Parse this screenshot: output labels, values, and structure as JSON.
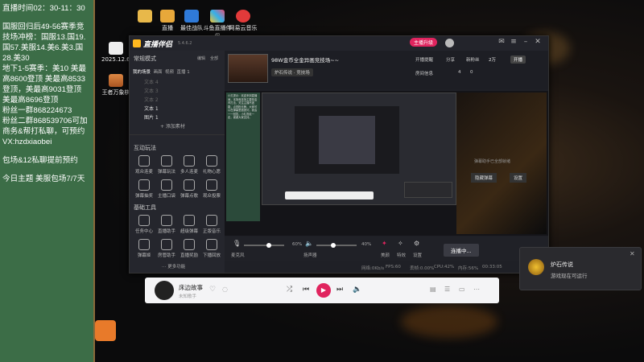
{
  "board": {
    "lines": [
      "直播时间02：30-11：30",
      "",
      "国服回归后49-56赛季竞技场冲榜：国服13.国19.国57.美服14.美6.美3.国28.美30",
      "地下1-5赛季：美10 美最高8600登顶 美最高8533登顶，美最高9031登顶 美最高8696登顶",
      "粉丝一群868224673",
      "粉丝二群868539706可加商务&帮打私聊，可预约",
      "VX:hzdxiaobei",
      "",
      "包场&12私聊提前预约",
      "",
      "今日主题  美服包场7/7天"
    ]
  },
  "desktop": {
    "icons": [
      "",
      "直播",
      "最佳战队",
      "斗鱼直播伴侣",
      "网易云音乐"
    ],
    "left_icons": [
      "2025.12.6...",
      "王者万象棋"
    ]
  },
  "app": {
    "name": "直播伴侣",
    "version": "5.4.6.2",
    "live_stream_btn": "主播升级",
    "share_label": "分享",
    "live_remind": "开播提醒",
    "upgrade": "升级",
    "new_fans": "新粉丝",
    "fans_count": "2万",
    "watch_label": "开播",
    "stream_title": "98W金币全金异画竞技场~~",
    "category": "炉石传说 · 竞技场",
    "room_info_label": "房间信息",
    "room_stat1": "4",
    "room_stat2": "0",
    "mode_label": "常规模式",
    "mode_edit": "编辑",
    "mode_more": "全部",
    "scene_tabs": [
      "我的场景",
      "画面",
      "视频",
      "直播 1"
    ],
    "scenes": [
      "文本 4",
      "文本 3",
      "文本 2",
      "文本 1",
      "图片 1"
    ],
    "add_material": "+ 添加素材",
    "tools_title": "互动玩法",
    "tools": [
      "观众连麦",
      "弹幕玩法",
      "多人连麦",
      "礼物心愿",
      "弹幕抽奖",
      "主播口袋",
      "弹幕点歌",
      "观众投票"
    ],
    "basic_title": "基础工具",
    "basic_tools": [
      "任务中心",
      "直播助手",
      "超级弹幕",
      "正版音乐",
      "弹幕姬",
      "房管助手",
      "直播奖励",
      "下播回放"
    ],
    "more_functions": "更多功能",
    "mic_label": "麦克风",
    "mic_pct": "60%",
    "spk_label": "扬声器",
    "spk_pct": "40%",
    "beauty_label": "美颜",
    "effects_label": "特效",
    "settings_label": "设置",
    "connect_btn": "连播中...",
    "status_items": [
      "网络:0Kb/s",
      "FPS:60",
      "丢帧:0.00%",
      "CPU:42%",
      "内存:56%",
      "00:33:05"
    ],
    "side_msg": "弹幕助手已全部就绪",
    "side_btn1": "隐藏弹幕",
    "side_btn2": "设置",
    "chat_text": "小贝提示：欢迎来到直播间，本场竞技场主要是金币打法，关注主播不迷路，点亮粉丝牌，大家可以在弹幕里面提问，我会一一回答，小礼物走一走，谢谢大家支持。"
  },
  "player": {
    "song": "床边故事",
    "artist": "未知歌手"
  },
  "notification": {
    "app": "炉石传说",
    "message": "游戏现在可运行"
  },
  "colors": {
    "board_bg": "#3c6d47",
    "accent_red": "#e0245e",
    "app_bg": "#1f2026"
  }
}
